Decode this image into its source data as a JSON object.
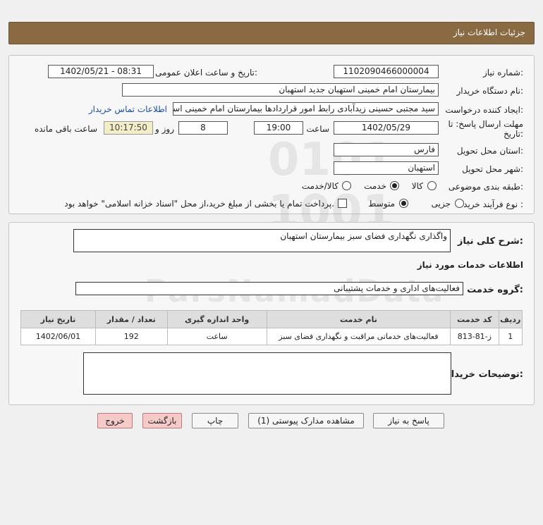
{
  "header": {
    "title": "جزئیات اطلاعات نیاز"
  },
  "form": {
    "need_number_label": "شماره نیاز:",
    "need_number": "1102090466000004",
    "announce_label": "تاریخ و ساعت اعلان عمومی:",
    "announce_value": "1402/05/21 - 08:31",
    "buyer_org_label": "نام دستگاه خریدار:",
    "buyer_org": "بیمارستان امام خمینی استهبان جدید استهبان",
    "requester_label": "ایجاد کننده درخواست:",
    "requester": "سید مجتبی حسینی زیدآبادی رابط امور قراردادها بیمارستان امام خمینی استهبان",
    "contact_link": "اطلاعات تماس خریدار",
    "deadline_label": "مهلت ارسال پاسخ: تا تاریخ:",
    "deadline_date": "1402/05/29",
    "time_label": "ساعت",
    "deadline_time": "19:00",
    "days_value": "8",
    "days_label": "روز و",
    "remaining_time": "10:17:50",
    "remaining_label": "ساعت باقی مانده",
    "province_label": "استان محل تحویل:",
    "province": "فارس",
    "city_label": "شهر محل تحویل:",
    "city": "استهبان",
    "category_label": "طبقه بندی موضوعی:",
    "category_options": [
      "کالا",
      "خدمت",
      "کالا/خدمت"
    ],
    "category_selected": "خدمت",
    "purchase_type_label": "نوع فرآیند خرید :",
    "purchase_options": [
      "جزیی",
      "متوسط"
    ],
    "purchase_selected": "متوسط",
    "payment_note": "پرداخت تمام یا بخشی از مبلغ خرید،از محل \"اسناد خزانه اسلامی\" خواهد بود."
  },
  "details": {
    "general_desc_label": "شرح کلی نیاز:",
    "general_desc": "واگذاری نگهداری فضای سبز بیمارستان استهبان",
    "services_info_title": "اطلاعات خدمات مورد نیاز",
    "service_group_label": "گروه خدمت:",
    "service_group": "فعالیت‌های اداری و خدمات پشتیبانی",
    "table": {
      "headers": [
        "ردیف",
        "کد خدمت",
        "نام خدمت",
        "واحد اندازه گیری",
        "تعداد / مقدار",
        "تاریخ نیاز"
      ],
      "rows": [
        [
          "1",
          "ز-81-813",
          "فعالیت‌های خدماتی مراقبت و نگهداری فضای سبز",
          "ساعت",
          "192",
          "1402/06/01"
        ]
      ]
    },
    "buyer_notes_label": "توضیحات خریدار:",
    "buyer_notes": ""
  },
  "buttons": {
    "reply": "پاسخ به نیاز",
    "view_docs": "مشاهده مدارک پیوستی (1)",
    "print": "چاپ",
    "back": "بازگشت",
    "exit": "خروج"
  },
  "colors": {
    "header_bg": "#8a6a42",
    "link": "#1a4fa6",
    "exit_btn": "#f7caca"
  }
}
